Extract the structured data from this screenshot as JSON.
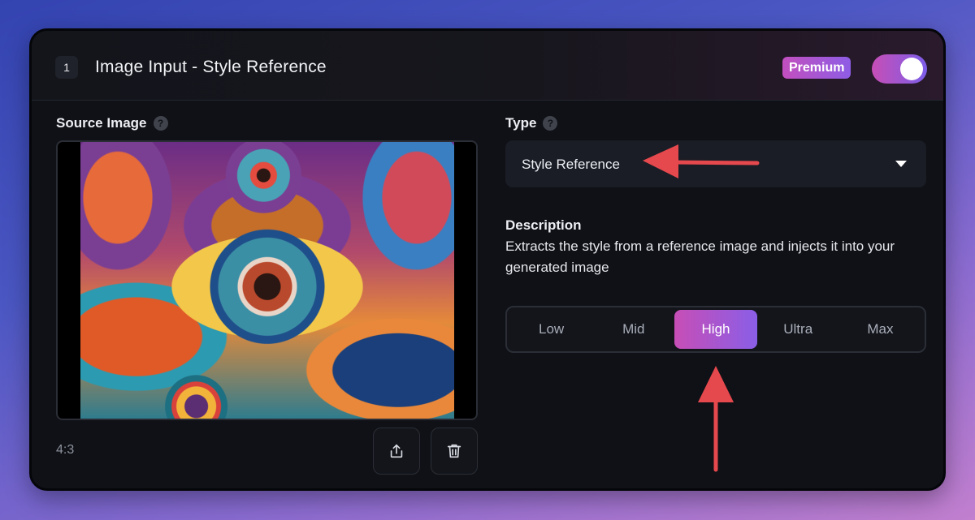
{
  "header": {
    "step_number": "1",
    "title": "Image Input - Style Reference",
    "badge": "Premium",
    "toggle_on": true
  },
  "source": {
    "label": "Source Image",
    "help": "?",
    "aspect_ratio": "4:3",
    "upload_icon": "upload-icon",
    "delete_icon": "trash-icon"
  },
  "type": {
    "label": "Type",
    "help": "?",
    "selected": "Style Reference"
  },
  "description": {
    "title": "Description",
    "text": "Extracts the style from a reference image and injects it into your generated image"
  },
  "strength": {
    "options": [
      "Low",
      "Mid",
      "High",
      "Ultra",
      "Max"
    ],
    "selected": "High"
  },
  "colors": {
    "accent_start": "#c74eb6",
    "accent_end": "#8a5ee7",
    "arrow": "#e5484d",
    "card_bg": "#0f1116"
  }
}
